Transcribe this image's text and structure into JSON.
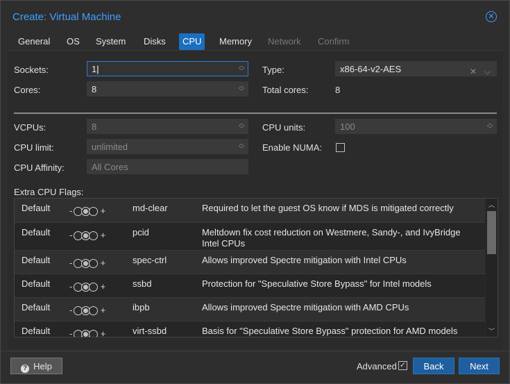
{
  "dialog": {
    "title": "Create: Virtual Machine",
    "close_icon": "close-circle-icon"
  },
  "tabs": [
    {
      "label": "General",
      "state": "normal"
    },
    {
      "label": "OS",
      "state": "normal"
    },
    {
      "label": "System",
      "state": "normal"
    },
    {
      "label": "Disks",
      "state": "normal"
    },
    {
      "label": "CPU",
      "state": "active"
    },
    {
      "label": "Memory",
      "state": "normal"
    },
    {
      "label": "Network",
      "state": "disabled"
    },
    {
      "label": "Confirm",
      "state": "disabled"
    }
  ],
  "basic": {
    "sockets_label": "Sockets:",
    "sockets_value": "1",
    "cores_label": "Cores:",
    "cores_value": "8",
    "type_label": "Type:",
    "type_value": "x86-64-v2-AES",
    "total_cores_label": "Total cores:",
    "total_cores_value": "8"
  },
  "advanced": {
    "vcpus_label": "VCPUs:",
    "vcpus_value": "8",
    "cpu_limit_label": "CPU limit:",
    "cpu_limit_value": "unlimited",
    "cpu_affinity_label": "CPU Affinity:",
    "cpu_affinity_placeholder": "All Cores",
    "cpu_units_label": "CPU units:",
    "cpu_units_value": "100",
    "numa_label": "Enable NUMA:",
    "numa_checked": false
  },
  "flags": {
    "label": "Extra CPU Flags:",
    "rows": [
      {
        "state": "Default",
        "minus": "-",
        "plus": "+",
        "name": "md-clear",
        "desc": "Required to let the guest OS know if MDS is mitigated correctly"
      },
      {
        "state": "Default",
        "minus": "-",
        "plus": "+",
        "name": "pcid",
        "desc": "Meltdown fix cost reduction on Westmere, Sandy-, and IvyBridge Intel CPUs"
      },
      {
        "state": "Default",
        "minus": "-",
        "plus": "+",
        "name": "spec-ctrl",
        "desc": "Allows improved Spectre mitigation with Intel CPUs"
      },
      {
        "state": "Default",
        "minus": "-",
        "plus": "+",
        "name": "ssbd",
        "desc": "Protection for \"Speculative Store Bypass\" for Intel models"
      },
      {
        "state": "Default",
        "minus": "-",
        "plus": "+",
        "name": "ibpb",
        "desc": "Allows improved Spectre mitigation with AMD CPUs"
      },
      {
        "state": "Default",
        "minus": "-",
        "plus": "+",
        "name": "virt-ssbd",
        "desc": "Basis for \"Speculative Store Bypass\" protection for AMD models"
      }
    ]
  },
  "footer": {
    "help_label": "Help",
    "advanced_label": "Advanced",
    "advanced_checked": true,
    "back_label": "Back",
    "next_label": "Next"
  },
  "colors": {
    "accent": "#3ea0ff",
    "active_tab": "#1b6fbf",
    "primary_button": "#1f5f9f"
  }
}
